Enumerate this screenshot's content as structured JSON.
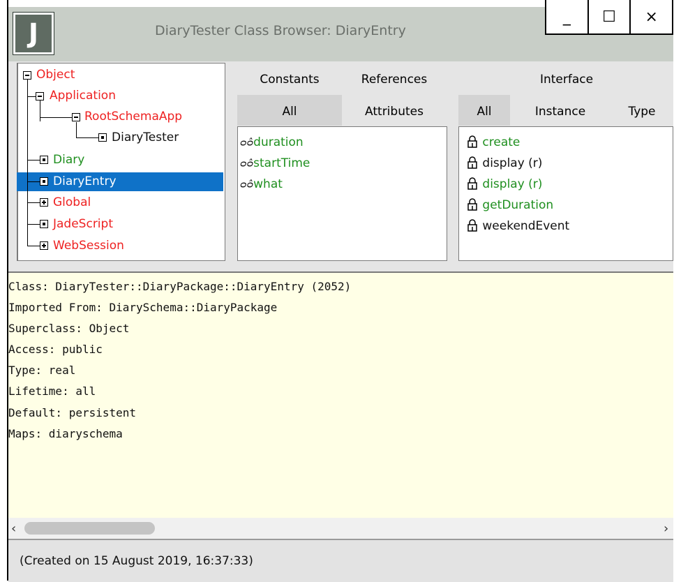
{
  "window": {
    "title": "DiaryTester Class Browser: DiaryEntry",
    "logo_letter": "J",
    "buttons": {
      "minimize": "_",
      "maximize": "☐",
      "close": "×"
    }
  },
  "class_tree": [
    {
      "label": "Object",
      "color": "#ee2222",
      "toggle": "minus"
    },
    {
      "label": "Application",
      "color": "#ee2222",
      "toggle": "minus"
    },
    {
      "label": "RootSchemaApp",
      "color": "#ee2222",
      "toggle": "minus"
    },
    {
      "label": "DiaryTester",
      "color": "#111111",
      "toggle": "leaf"
    },
    {
      "label": "Diary",
      "color": "#1f8f1f",
      "toggle": "leaf"
    },
    {
      "label": "DiaryEntry",
      "color": "#ffffff",
      "toggle": "leaf",
      "selected": true
    },
    {
      "label": "Global",
      "color": "#ee2222",
      "toggle": "plus"
    },
    {
      "label": "JadeScript",
      "color": "#ee2222",
      "toggle": "leaf"
    },
    {
      "label": "WebSession",
      "color": "#ee2222",
      "toggle": "plus"
    }
  ],
  "property_tabs": {
    "constants": "Constants",
    "references": "References",
    "all": "All",
    "attributes": "Attributes"
  },
  "properties": [
    {
      "icon": "glasses-icon",
      "glyph": "ᴑᴑ̂",
      "label": "duration"
    },
    {
      "icon": "glasses-icon",
      "glyph": "ᴑᴑ̂",
      "label": "startTime"
    },
    {
      "icon": "glasses-icon",
      "glyph": "ᴑᴑ̂",
      "label": "what"
    }
  ],
  "method_tabs": {
    "interface": "Interface",
    "all": "All",
    "instance": "Instance",
    "type": "Type"
  },
  "methods": [
    {
      "label": "create",
      "color": "#1f8f1f"
    },
    {
      "label": "display (r)",
      "color": "#111111"
    },
    {
      "label": "display (r)",
      "color": "#1f8f1f"
    },
    {
      "label": "getDuration",
      "color": "#1f8f1f"
    },
    {
      "label": "weekendEvent",
      "color": "#111111"
    }
  ],
  "details": [
    "Class: DiaryTester::DiaryPackage::DiaryEntry (2052)",
    "Imported From: DiarySchema::DiaryPackage",
    "Superclass: Object",
    "Access: public",
    "Type: real",
    "Lifetime: all",
    "Default: persistent",
    "Maps: diaryschema"
  ],
  "scroll": {
    "left_arrow": "‹",
    "right_arrow": "›"
  },
  "status": "(Created on 15 August 2019, 16:37:33)"
}
